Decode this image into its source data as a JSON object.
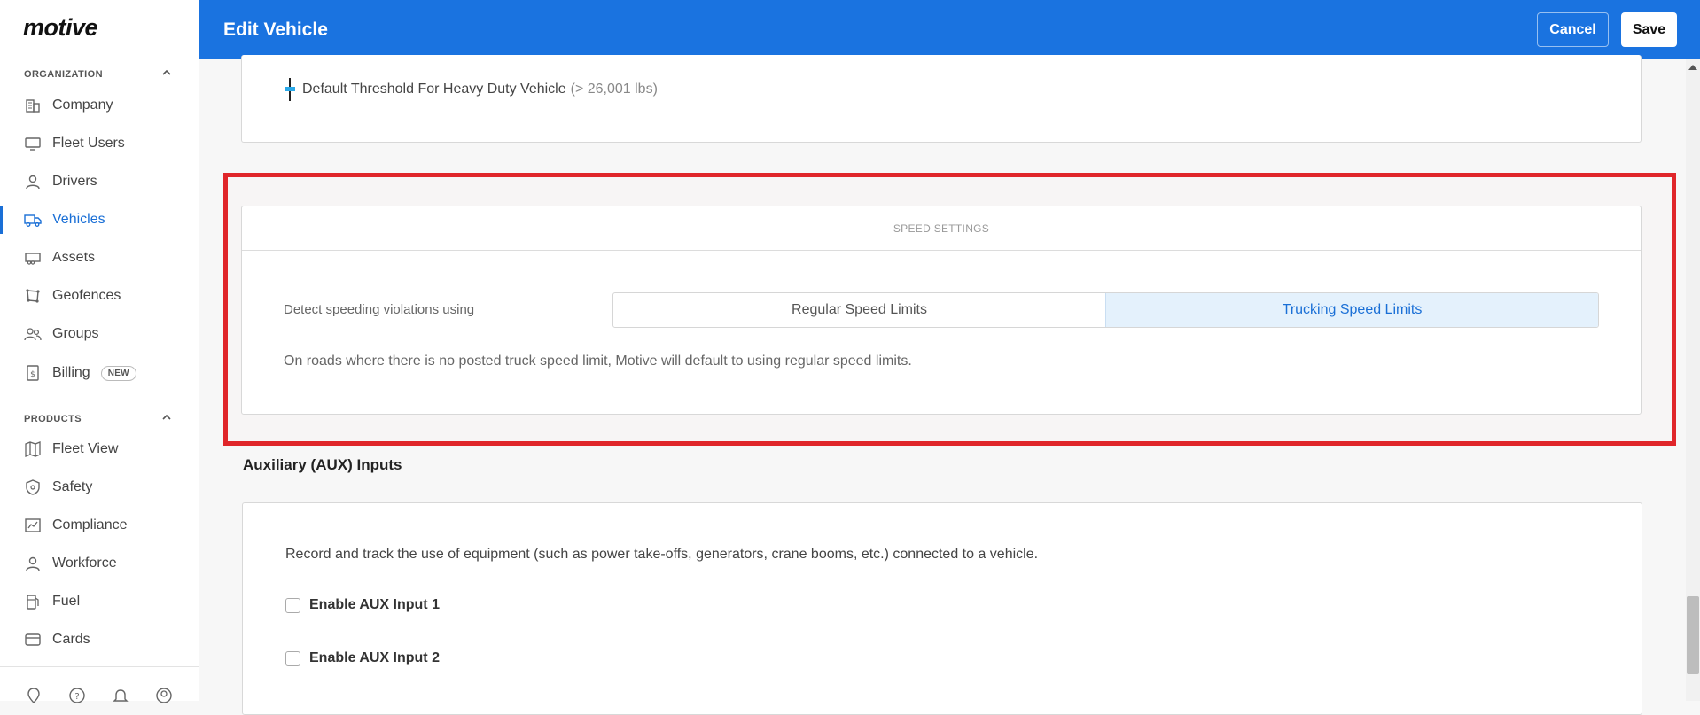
{
  "app": {
    "logo": "motive"
  },
  "header": {
    "title": "Edit Vehicle",
    "cancel_label": "Cancel",
    "save_label": "Save"
  },
  "sidebar": {
    "organization_label": "ORGANIZATION",
    "products_label": "PRODUCTS",
    "organization_items": [
      {
        "label": "Company",
        "icon": "building-icon"
      },
      {
        "label": "Fleet Users",
        "icon": "monitor-icon"
      },
      {
        "label": "Drivers",
        "icon": "person-icon"
      },
      {
        "label": "Vehicles",
        "icon": "truck-icon",
        "active": true
      },
      {
        "label": "Assets",
        "icon": "trailer-icon"
      },
      {
        "label": "Geofences",
        "icon": "geofence-icon"
      },
      {
        "label": "Groups",
        "icon": "group-icon"
      },
      {
        "label": "Billing",
        "icon": "billing-icon",
        "badge": "NEW"
      }
    ],
    "product_items": [
      {
        "label": "Fleet View",
        "icon": "map-icon"
      },
      {
        "label": "Safety",
        "icon": "shield-icon"
      },
      {
        "label": "Compliance",
        "icon": "chart-icon"
      },
      {
        "label": "Workforce",
        "icon": "person-icon"
      },
      {
        "label": "Fuel",
        "icon": "fuel-icon"
      },
      {
        "label": "Cards",
        "icon": "card-icon"
      }
    ],
    "bottom_icons": [
      "map-pin-icon",
      "help-icon",
      "bell-icon",
      "account-icon"
    ]
  },
  "threshold": {
    "label": "Default Threshold For Heavy Duty Vehicle",
    "note": "(> 26,001 lbs)"
  },
  "speed_settings": {
    "heading": "SPEED SETTINGS",
    "label": "Detect speeding violations using",
    "options": [
      "Regular Speed Limits",
      "Trucking Speed Limits"
    ],
    "selected": "Trucking Speed Limits",
    "note": "On roads where there is no posted truck speed limit, Motive will default to using regular speed limits."
  },
  "aux": {
    "title": "Auxiliary (AUX) Inputs",
    "description": "Record and track the use of equipment (such as power take-offs, generators, crane booms, etc.) connected to a vehicle.",
    "input1_label": "Enable AUX Input 1",
    "input2_label": "Enable AUX Input 2"
  },
  "colors": {
    "brand": "#1a73e0",
    "active": "#1a6fd6",
    "highlight": "#e0262a",
    "selected_bg": "#e4f1fc"
  }
}
